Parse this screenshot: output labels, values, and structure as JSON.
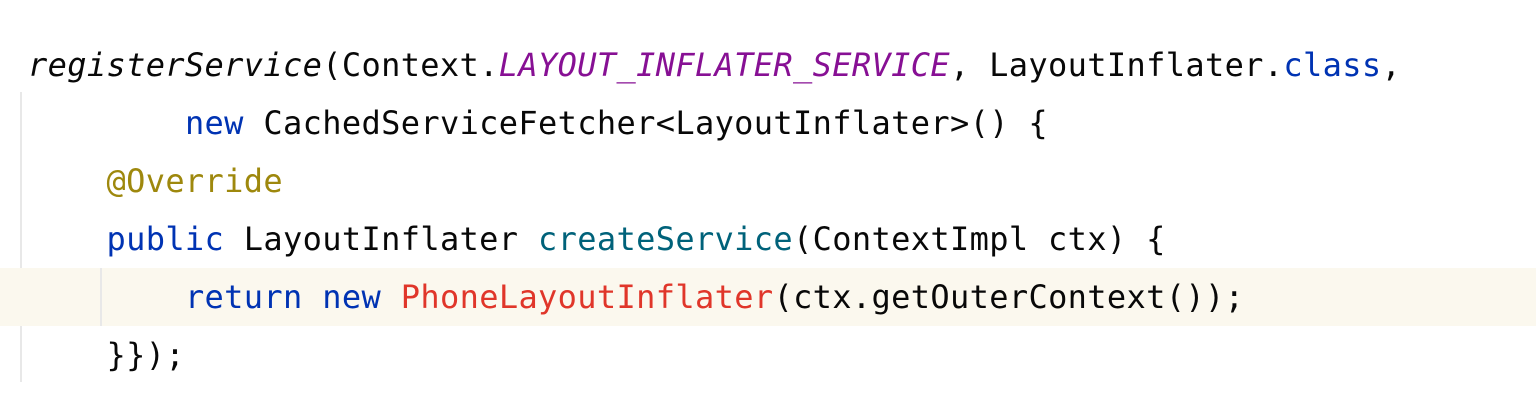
{
  "code": {
    "line1": {
      "method": "registerService",
      "p1": "(Context.",
      "constant": "LAYOUT_INFLATER_SERVICE",
      "p2": ", LayoutInflater.",
      "kw": "class",
      "p3": ","
    },
    "line2": {
      "indent": "        ",
      "kw": "new",
      "rest": " CachedServiceFetcher<LayoutInflater>() {"
    },
    "line3": {
      "indent": "    ",
      "annotation": "@Override"
    },
    "line4": {
      "indent": "    ",
      "kw": "public",
      "p1": " LayoutInflater ",
      "method": "createService",
      "rest": "(ContextImpl ctx) {"
    },
    "line5": {
      "indent": "        ",
      "kw1": "return",
      "sp": " ",
      "kw2": "new",
      "sp2": " ",
      "cls": "PhoneLayoutInflater",
      "rest": "(ctx.getOuterContext());"
    },
    "line6": {
      "indent": "    ",
      "rest": "}});"
    }
  }
}
